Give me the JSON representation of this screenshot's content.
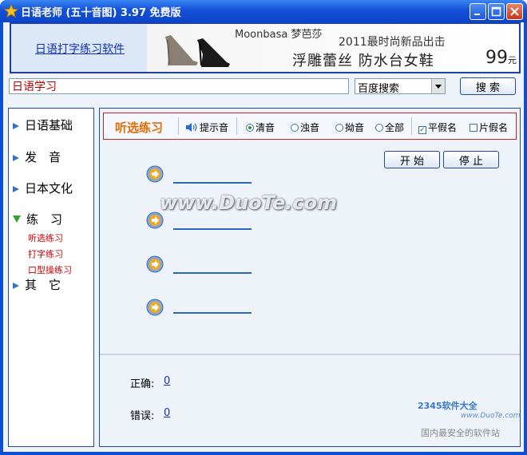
{
  "window": {
    "title": "日语老师 (五十音图) 3.97 免费版"
  },
  "banner": {
    "link_text": "日语打字练习软件",
    "brand": "Moonbasa 梦芭莎",
    "ad_line1": "2011最时尚新品出击",
    "ad_line2": "浮雕蕾丝  防水台女鞋",
    "price": "99",
    "price_unit": "元"
  },
  "search": {
    "value": "日语学习",
    "engine": "百度搜索",
    "button_label": "搜  索"
  },
  "sidebar": {
    "items": [
      {
        "label": "日语基础"
      },
      {
        "label": "发　音"
      },
      {
        "label": "日本文化"
      },
      {
        "label": "练　习"
      },
      {
        "label": "其　它"
      }
    ],
    "sub_items": [
      {
        "label": "听选练习"
      },
      {
        "label": "打字练习"
      },
      {
        "label": "口型操练习"
      }
    ]
  },
  "options": {
    "title": "听选练习",
    "hint_sound": "提示音",
    "radios": [
      {
        "label": "清音",
        "selected": true
      },
      {
        "label": "浊音",
        "selected": false
      },
      {
        "label": "拗音",
        "selected": false
      },
      {
        "label": "全部",
        "selected": false
      }
    ],
    "checks": [
      {
        "label": "平假名",
        "checked": true
      },
      {
        "label": "片假名",
        "checked": false
      }
    ]
  },
  "controls": {
    "start_label": "开  始",
    "stop_label": "停  止"
  },
  "score": {
    "correct_label": "正确:",
    "correct_value": "0",
    "wrong_label": "错误:",
    "wrong_value": "0"
  },
  "watermark": {
    "main": "www.DuoTe.com",
    "logo": "2345软件大全",
    "url": "www.DuoTe.com",
    "text": "国内最安全的软件站"
  },
  "colors": {
    "title_bar": "#0b45c9",
    "option_title": "#e36c09",
    "sub_item": "#d00000",
    "link": "#1030c0"
  }
}
